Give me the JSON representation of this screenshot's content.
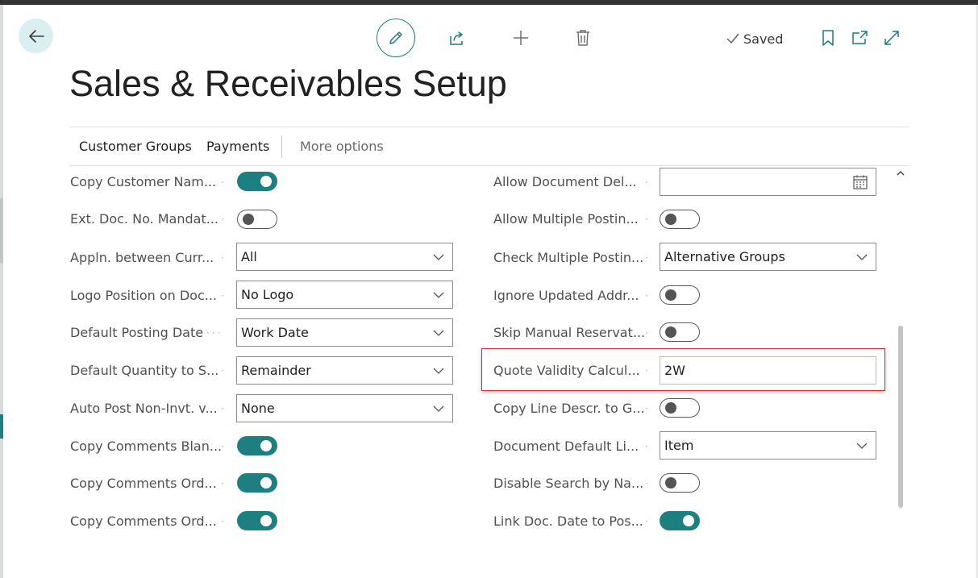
{
  "header": {
    "title": "Sales & Receivables Setup",
    "saved_label": "Saved"
  },
  "actions": [
    {
      "label": "Customer Groups"
    },
    {
      "label": "Payments"
    },
    {
      "label": "More options"
    }
  ],
  "left_fields": [
    {
      "label": "Copy Customer Nam...",
      "type": "toggle",
      "value": "on"
    },
    {
      "label": "Ext. Doc. No. Mandat...",
      "type": "toggle",
      "value": "off"
    },
    {
      "label": "Appln. between Curr...",
      "type": "select",
      "value": "All"
    },
    {
      "label": "Logo Position on Doc...",
      "type": "select",
      "value": "No Logo"
    },
    {
      "label": "Default Posting Date",
      "type": "select",
      "value": "Work Date"
    },
    {
      "label": "Default Quantity to S...",
      "type": "select",
      "value": "Remainder"
    },
    {
      "label": "Auto Post Non-Invt. v...",
      "type": "select",
      "value": "None"
    },
    {
      "label": "Copy Comments Blan...",
      "type": "toggle",
      "value": "on"
    },
    {
      "label": "Copy Comments Ord...",
      "type": "toggle",
      "value": "on"
    },
    {
      "label": "Copy Comments Ord...",
      "type": "toggle",
      "value": "on"
    }
  ],
  "right_fields": [
    {
      "label": "Allow Document Del...",
      "type": "date",
      "value": ""
    },
    {
      "label": "Allow Multiple Postin...",
      "type": "toggle",
      "value": "off"
    },
    {
      "label": "Check Multiple Postin...",
      "type": "select",
      "value": "Alternative Groups"
    },
    {
      "label": "Ignore Updated Addr...",
      "type": "toggle",
      "value": "off"
    },
    {
      "label": "Skip Manual Reservat...",
      "type": "toggle",
      "value": "off"
    },
    {
      "label": "Quote Validity Calcul...",
      "type": "text",
      "value": "2W"
    },
    {
      "label": "Copy Line Descr. to G...",
      "type": "toggle",
      "value": "off"
    },
    {
      "label": "Document Default Li...",
      "type": "select",
      "value": "Item"
    },
    {
      "label": "Disable Search by Na...",
      "type": "toggle",
      "value": "off"
    },
    {
      "label": "Link Doc. Date to Pos...",
      "type": "toggle",
      "value": "on"
    }
  ],
  "icons": {
    "back": "arrow-left-icon",
    "edit": "pencil-icon",
    "share": "share-icon",
    "add": "plus-icon",
    "delete": "trash-icon",
    "saved": "check-icon",
    "bookmark": "bookmark-icon",
    "popout": "open-in-new-window-icon",
    "expand": "expand-icon",
    "calendar": "calendar-icon",
    "dropdown": "chevron-down-icon"
  },
  "colors": {
    "accent": "#1e7f80",
    "highlight_border": "#d42a2a",
    "back_button_bg": "#dbeef0"
  }
}
